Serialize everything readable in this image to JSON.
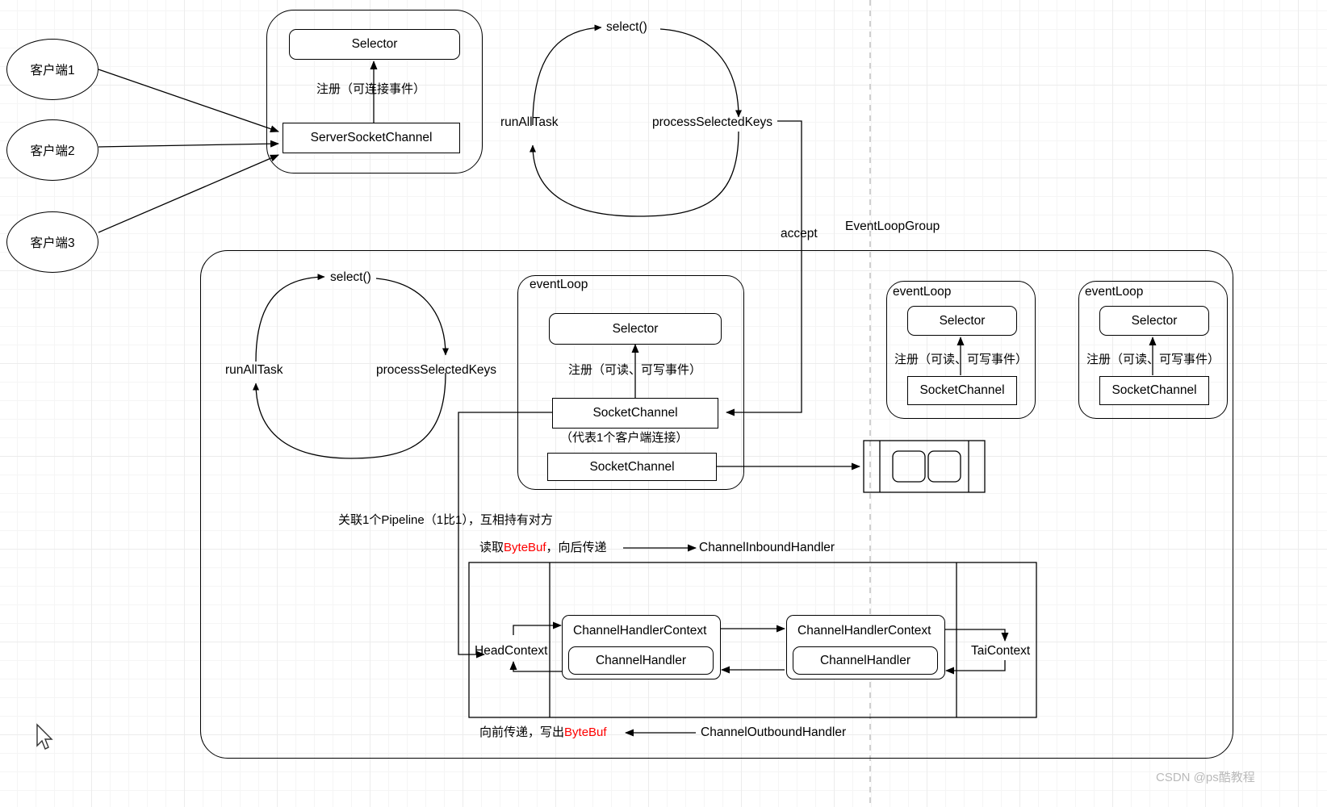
{
  "diagram": {
    "title": "Netty EventLoopGroup / Pipeline architecture diagram",
    "watermark": "CSDN @ps酷教程",
    "colors": {
      "stroke": "#000000",
      "grid": "#ececec",
      "accent_red": "#ff0000",
      "watermark": "#b9b9b9"
    }
  },
  "clients": [
    {
      "label": "客户端1"
    },
    {
      "label": "客户端2"
    },
    {
      "label": "客户端3"
    }
  ],
  "boss_group": {
    "selector_label": "Selector",
    "register_label": "注册（可连接事件）",
    "server_socket_channel_label": "ServerSocketChannel"
  },
  "boss_loop": {
    "select_label": "select()",
    "process_label": "processSelectedKeys",
    "run_all_task_label": "runAllTask"
  },
  "accept_label": "accept",
  "event_loop_group_label": "EventLoopGroup",
  "worker_loop": {
    "select_label": "select()",
    "process_label": "processSelectedKeys",
    "run_all_task_label": "runAllTask"
  },
  "event_loops": [
    {
      "title": "eventLoop",
      "selector_label": "Selector",
      "register_label": "注册（可读、可写事件）",
      "channels": [
        "SocketChannel",
        "SocketChannel"
      ],
      "channel_note": "（代表1个客户端连接）"
    },
    {
      "title": "eventLoop",
      "selector_label": "Selector",
      "register_label": "注册（可读、可写事件）",
      "channels": [
        "SocketChannel"
      ]
    },
    {
      "title": "eventLoop",
      "selector_label": "Selector",
      "register_label": "注册（可读、可写事件）",
      "channels": [
        "SocketChannel"
      ]
    }
  ],
  "pipeline": {
    "association_note": "关联1个Pipeline（1比1），互相持有对方",
    "inbound": {
      "prefix": "读取",
      "highlight": "ByteBuf",
      "suffix": "，向后传递",
      "handler_label": "ChannelInboundHandler"
    },
    "outbound": {
      "prefix": "向前传递，写出",
      "highlight": "ByteBuf",
      "suffix": "",
      "handler_label": "ChannelOutboundHandler"
    },
    "head_context_label": "HeadContext",
    "tail_context_label": "TaiContext",
    "contexts": [
      {
        "context_label": "ChannelHandlerContext",
        "handler_label": "ChannelHandler"
      },
      {
        "context_label": "ChannelHandlerContext",
        "handler_label": "ChannelHandler"
      }
    ]
  }
}
